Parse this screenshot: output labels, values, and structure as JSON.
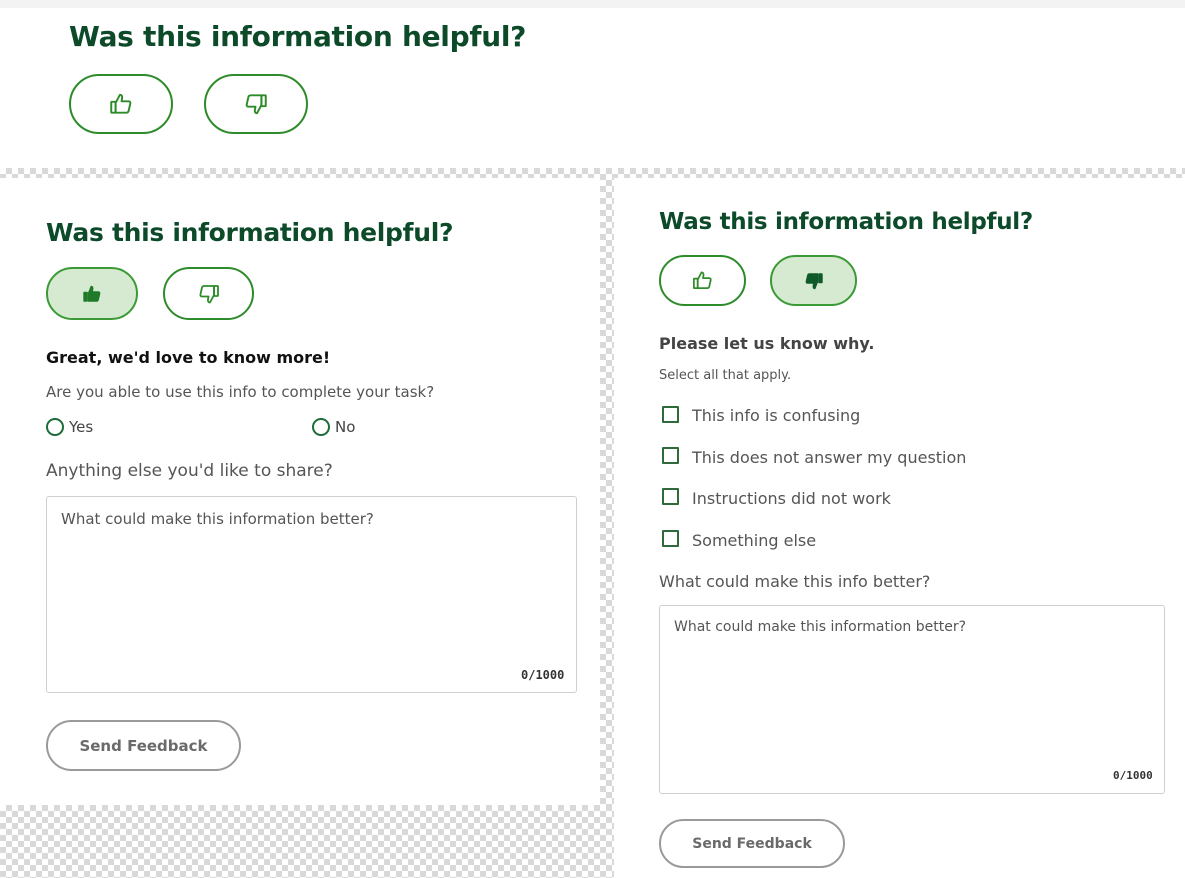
{
  "top_widget": {
    "heading": "Was this information helpful?",
    "thumbs_up_icon": "thumbs-up-outline-icon",
    "thumbs_down_icon": "thumbs-down-outline-icon"
  },
  "positive_panel": {
    "heading": "Was this information helpful?",
    "selected_vote": "thumbs-up",
    "followup_title": "Great, we'd love to know more!",
    "question": "Are you able to use this info to complete your task?",
    "options": [
      "Yes",
      "No"
    ],
    "share_label": "Anything else you'd like to share?",
    "textarea_placeholder": "What could make this information better?",
    "counter": "0/1000",
    "submit_label": "Send Feedback"
  },
  "negative_panel": {
    "heading": "Was this information helpful?",
    "selected_vote": "thumbs-down",
    "followup_title": "Please let us know why.",
    "hint": "Select all that apply.",
    "reasons": [
      "This info is confusing",
      "This does not answer my question",
      "Instructions did not work",
      "Something else"
    ],
    "better_label": "What could make this info better?",
    "textarea_placeholder": "What could make this information better?",
    "counter": "0/1000",
    "submit_label": "Send Feedback"
  },
  "colors": {
    "heading": "#0c4a2a",
    "accent_green": "#2e8b2a",
    "selected_fill": "#d5ead0",
    "button_gray": "#9a9a9a"
  }
}
